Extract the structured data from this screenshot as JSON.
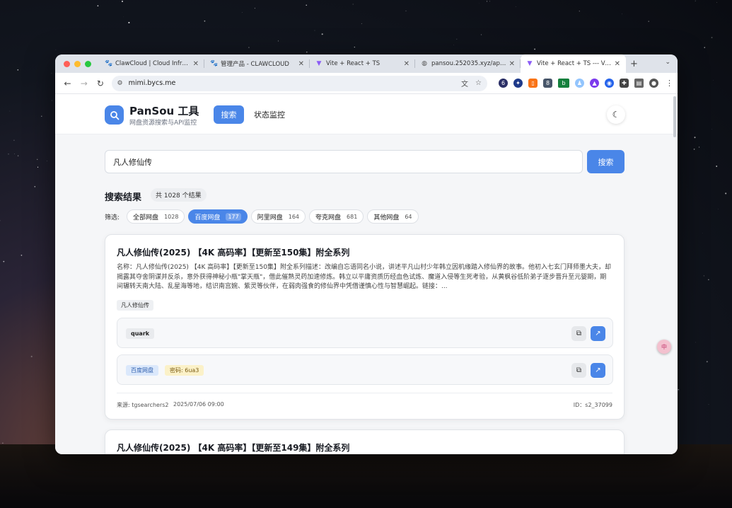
{
  "browser": {
    "tabs": [
      {
        "title": "ClawCloud | Cloud Infrastr...",
        "icon": "paw-icon",
        "active": false
      },
      {
        "title": "管理产品 - CLAWCLOUD",
        "icon": "paw-icon",
        "active": false
      },
      {
        "title": "Vite + React + TS",
        "icon": "vite-icon",
        "active": false
      },
      {
        "title": "pansou.252035.xyz/api/se...",
        "icon": "globe-icon",
        "active": false
      },
      {
        "title": "Vite + React + TS --- Vite...",
        "icon": "vite-icon",
        "active": true
      }
    ],
    "new_tab": "+",
    "url": "mimi.bycs.me",
    "extension_badges": {
      "e1": "6",
      "e4": "8"
    }
  },
  "app": {
    "brand": "PanSou 工具",
    "brand_sub": "网盘资源搜索与API监控",
    "nav_search": "搜索",
    "nav_monitor": "状态监控",
    "search_query": "凡人修仙传",
    "search_button": "搜索",
    "results_title": "搜索结果",
    "results_count": "共 1028 个结果",
    "filter_label": "筛选:",
    "filters": [
      {
        "label": "全部网盘",
        "count": "1028",
        "active": false
      },
      {
        "label": "百度网盘",
        "count": "177",
        "active": true
      },
      {
        "label": "阿里网盘",
        "count": "164",
        "active": false
      },
      {
        "label": "夸克网盘",
        "count": "681",
        "active": false
      },
      {
        "label": "其他网盘",
        "count": "64",
        "active": false
      }
    ],
    "results": [
      {
        "title": "凡人修仙传(2025) 【4K 高码率】【更新至150集】附全系列",
        "description": "名称：凡人修仙传(2025) 【4K 高码率】【更新至150集】附全系列描述：改编自忘语同名小说，讲述平凡山村少年韩立因机缘踏入修仙界的故事。他初入七玄门拜师墨大夫，却揭露其夺舍阴谋并反杀，意外获得神秘小瓶\"掌天瓶\"，借此催熟灵药加速修炼。韩立以平庸资质历经血色试炼、魔道入侵等生死考验，从黄枫谷低阶弟子逐步晋升至元婴期，期间辗转天南大陆、乱星海等地，结识南宫婉、紫灵等伙伴，在弱肉强食的修仙界中凭借谨慎心性与智慧崛起。链接：...",
        "tag": "凡人修仙传",
        "links": [
          {
            "type": "quark",
            "password": ""
          },
          {
            "type": "百度网盘",
            "password": "密码: 6ua3"
          }
        ],
        "source": "来源: tgsearchers2",
        "time": "2025/07/06 09:00",
        "id": "ID：s2_37099"
      },
      {
        "title": "凡人修仙传(2025) 【4K 高码率】【更新至149集】附全系列"
      }
    ],
    "floater_text": "中",
    "colors": {
      "accent": "#4a86e8",
      "pill_blue_bg": "#dbe8fb",
      "pill_yellow_bg": "#fbf1c8"
    }
  }
}
